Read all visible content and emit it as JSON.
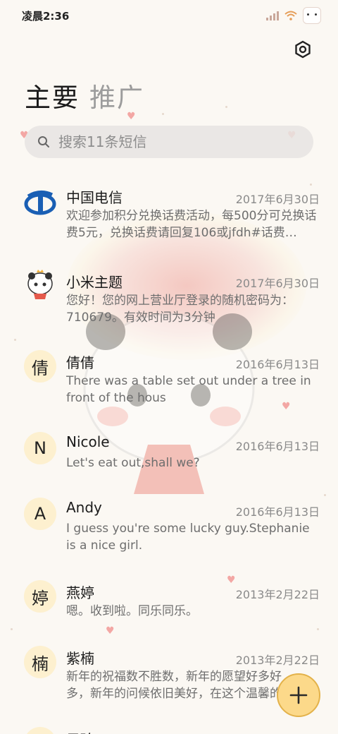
{
  "status_bar": {
    "time": "凌晨2:36"
  },
  "tabs": [
    {
      "label": "主要",
      "active": true
    },
    {
      "label": "推广",
      "active": false
    }
  ],
  "search": {
    "placeholder": "搜索11条短信"
  },
  "conversations": [
    {
      "avatar": "",
      "avatar_icon": "china-telecom-logo",
      "name": "中国电信",
      "date": "2017年6月30日",
      "message": "欢迎参加积分兑换话费活动，每500分可兑换话费5元，兑换话费请回复106或jfdh#话费…"
    },
    {
      "avatar": "",
      "avatar_icon": "xiaomi-theme-mascot",
      "name": "小米主题",
      "date": "2017年6月30日",
      "message": "您好！您的网上营业厅登录的随机密码为：710679。有效时间为3分钟"
    },
    {
      "avatar": "倩",
      "name": "倩倩",
      "date": "2016年6月13日",
      "message": "There was a table set out under a tree in front of the hous"
    },
    {
      "avatar": "N",
      "name": "Nicole",
      "date": "2016年6月13日",
      "message": "Let's eat out,shall we?"
    },
    {
      "avatar": "A",
      "name": "Andy",
      "date": "2016年6月13日",
      "message": "I guess you're some lucky guy.Stephanie is a nice girl."
    },
    {
      "avatar": "婷",
      "name": "燕婷",
      "date": "2013年2月22日",
      "message": "嗯。收到啦。同乐同乐。"
    },
    {
      "avatar": "楠",
      "name": "紫楠",
      "date": "2013年2月22日",
      "message": "新年的祝福数不胜数，新年的愿望好多好多，新年的问候依旧美好，在这个温馨的时刻"
    },
    {
      "avatar": "",
      "name": "子玲",
      "date": "",
      "message": ""
    }
  ],
  "colors": {
    "accent": "#fcd98a",
    "avatar_bg": "#fdf0cf"
  }
}
